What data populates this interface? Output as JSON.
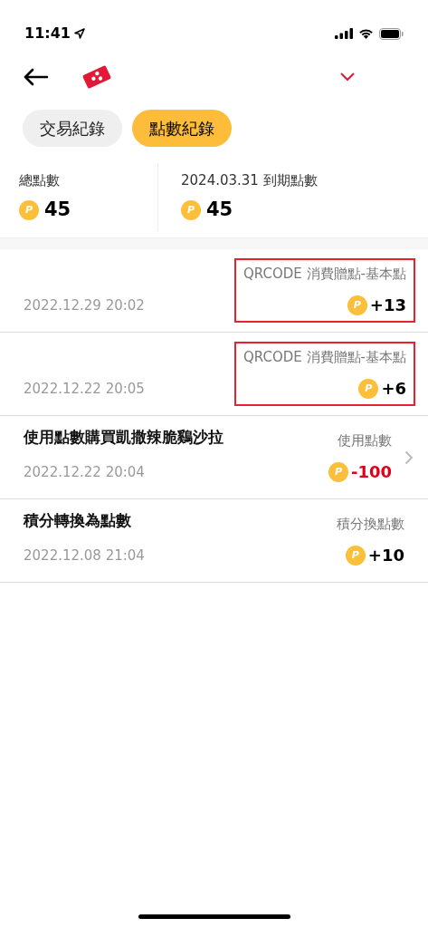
{
  "status_bar": {
    "time": "11:41"
  },
  "tabs": [
    {
      "label": "交易紀錄",
      "selected": false
    },
    {
      "label": "點數紀錄",
      "selected": true
    }
  ],
  "summary": [
    {
      "label": "總點數",
      "coin": "P",
      "value": "45"
    },
    {
      "label": "2024.03.31 到期點數",
      "coin": "P",
      "value": "45"
    }
  ],
  "records": [
    {
      "date": "2022.12.29 20:02",
      "category": "QRCODE 消費贈點-基本點",
      "coin": "P",
      "points": "+13",
      "kind": "earn",
      "highlighted": true,
      "has_detail": false
    },
    {
      "date": "2022.12.22 20:05",
      "category": "QRCODE 消費贈點-基本點",
      "coin": "P",
      "points": "+6",
      "kind": "earn",
      "highlighted": true,
      "has_detail": false
    },
    {
      "title": "使用點數購買凱撒辣脆鷄沙拉",
      "date": "2022.12.22 20:04",
      "category": "使用點數",
      "coin": "P",
      "points": "-100",
      "kind": "spend",
      "highlighted": false,
      "has_detail": true
    },
    {
      "title": "積分轉換為點數",
      "date": "2022.12.08 21:04",
      "category": "積分換點數",
      "coin": "P",
      "points": "+10",
      "kind": "earn",
      "highlighted": false,
      "has_detail": false
    }
  ]
}
